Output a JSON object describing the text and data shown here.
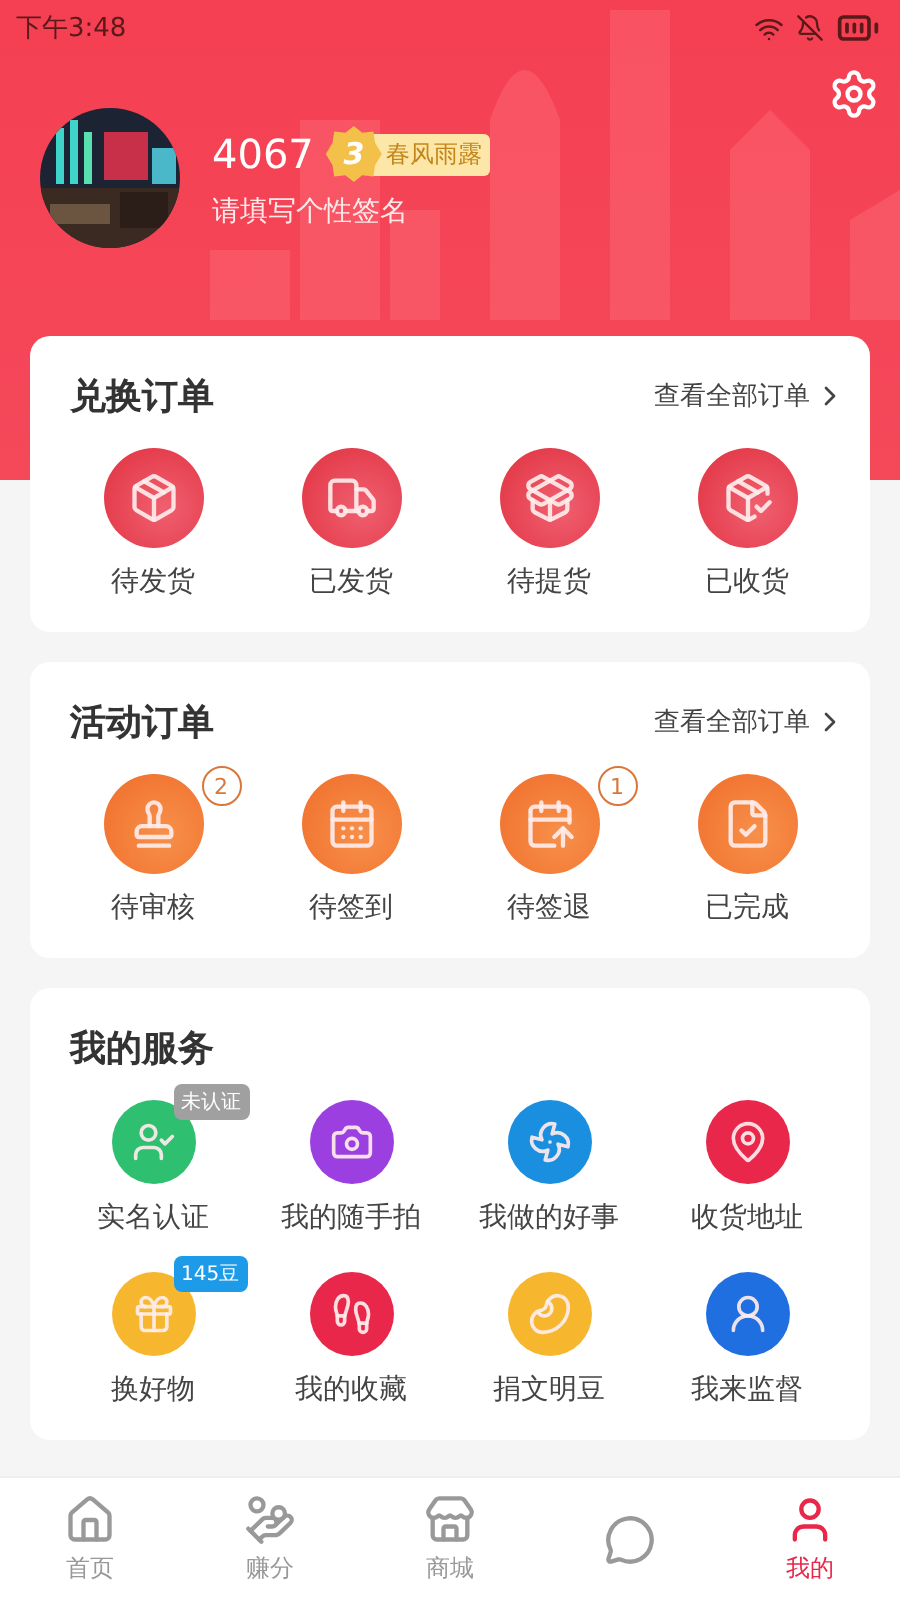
{
  "status_bar": {
    "time": "下午3:48"
  },
  "profile": {
    "name": "4067",
    "level": "3",
    "level_title": "春风雨露",
    "signature": "请填写个性签名"
  },
  "sections": [
    {
      "title": "兑换订单",
      "link": "查看全部订单",
      "items": [
        {
          "label": "待发货"
        },
        {
          "label": "已发货"
        },
        {
          "label": "待提货"
        },
        {
          "label": "已收货"
        }
      ]
    },
    {
      "title": "活动订单",
      "link": "查看全部订单",
      "items": [
        {
          "label": "待审核",
          "count": "2"
        },
        {
          "label": "待签到"
        },
        {
          "label": "待签退",
          "count": "1"
        },
        {
          "label": "已完成"
        }
      ]
    },
    {
      "title": "我的服务",
      "items": [
        {
          "label": "实名认证",
          "color": "#2fbf71",
          "tag": {
            "text": "未认证",
            "color": "#a0a0a0"
          }
        },
        {
          "label": "我的随手拍",
          "color": "#9b3fe0"
        },
        {
          "label": "我做的好事",
          "color": "#1a8fe0"
        },
        {
          "label": "收货地址",
          "color": "#e8274a"
        },
        {
          "label": "换好物",
          "color": "#f6b72e",
          "tag": {
            "text": "145豆",
            "color": "#1d9be8"
          }
        },
        {
          "label": "我的收藏",
          "color": "#e8274a"
        },
        {
          "label": "捐文明豆",
          "color": "#f6b72e"
        },
        {
          "label": "我来监督",
          "color": "#1f6fe0"
        }
      ]
    }
  ],
  "nav": [
    {
      "label": "首页",
      "selected": false
    },
    {
      "label": "赚分",
      "selected": false
    },
    {
      "label": "商城",
      "selected": false
    },
    {
      "selected": false
    },
    {
      "label": "我的",
      "selected": true
    }
  ]
}
